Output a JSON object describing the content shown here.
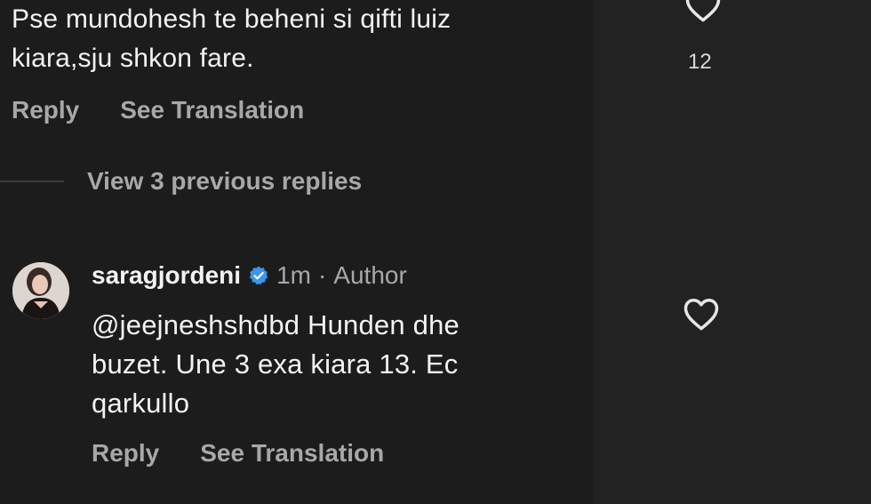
{
  "parent_comment": {
    "text_lines": [
      "Pse mundohesh te beheni si qifti luiz",
      "kiara,sju shkon fare."
    ],
    "like_count": "12",
    "actions": {
      "reply_label": "Reply",
      "translate_label": "See Translation"
    }
  },
  "thread": {
    "view_replies_label": "View 3 previous replies"
  },
  "reply": {
    "username": "saragjordeni",
    "time": "1m",
    "separator": "·",
    "role": "Author",
    "text_lines": [
      "@jeejneshshdbd Hunden dhe",
      "buzet. Une 3 exa kiara 13. Ec",
      "qarkullo"
    ],
    "actions": {
      "reply_label": "Reply",
      "translate_label": "See Translation"
    }
  },
  "colors": {
    "background": "#1c1c1d",
    "secondary_text": "#a8a8a8",
    "verified_badge": "#3897f0"
  }
}
